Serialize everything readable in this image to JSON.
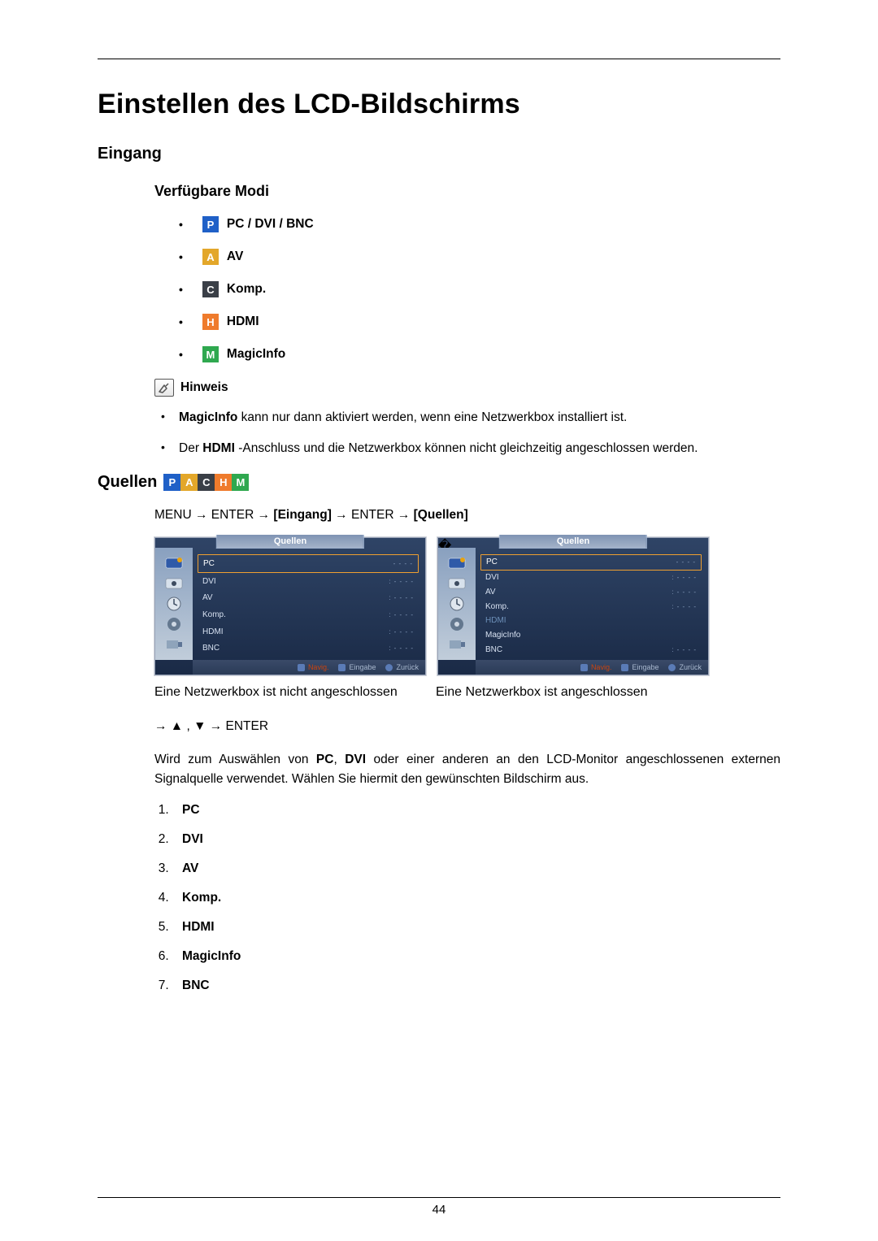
{
  "page_number": "44",
  "h1": "Einstellen des LCD-Bildschirms",
  "h2_eingang": "Eingang",
  "h3_modes": "Verfügbare Modi",
  "modes": [
    {
      "letter": "P",
      "cls": "sq-p",
      "label": "PC / DVI / BNC"
    },
    {
      "letter": "A",
      "cls": "sq-a",
      "label": "AV"
    },
    {
      "letter": "C",
      "cls": "sq-c",
      "label": "Komp."
    },
    {
      "letter": "H",
      "cls": "sq-h",
      "label": "HDMI"
    },
    {
      "letter": "M",
      "cls": "sq-m",
      "label": "MagicInfo"
    }
  ],
  "hinweis_label": "Hinweis",
  "notes": {
    "n1_strong": "MagicInfo",
    "n1_rest": " kann nur dann aktiviert werden, wenn eine Netzwerkbox installiert ist.",
    "n2_pre": "Der ",
    "n2_strong": "HDMI",
    "n2_rest": " -Anschluss und die Netzwerkbox können nicht gleichzeitig angeschlossen werden."
  },
  "quellen_label": "Quellen",
  "quellen_badges": [
    "P",
    "A",
    "C",
    "H",
    "M"
  ],
  "path": {
    "p1": "MENU → ENTER → ",
    "b1": "[Eingang]",
    "p2": " → ENTER → ",
    "b2": "[Quellen]"
  },
  "osd": {
    "title": "Quellen",
    "footer_nav": "Navig.",
    "footer_enter": "Eingabe",
    "footer_back": "Zurück",
    "left": {
      "rows": [
        {
          "label": "PC",
          "selected": true
        },
        {
          "label": "DVI"
        },
        {
          "label": "AV"
        },
        {
          "label": "Komp."
        },
        {
          "label": "HDMI"
        },
        {
          "label": "BNC"
        }
      ]
    },
    "right": {
      "rows": [
        {
          "label": "PC",
          "selected": true
        },
        {
          "label": "DVI"
        },
        {
          "label": "AV"
        },
        {
          "label": "Komp."
        },
        {
          "label": "HDMI",
          "dim": true
        },
        {
          "label": "MagicInfo"
        },
        {
          "label": "BNC"
        }
      ]
    }
  },
  "captions": {
    "left": "Eine Netzwerkbox ist nicht angeschlossen",
    "right": "Eine Netzwerkbox ist angeschlossen"
  },
  "nav_line": "→ ▲ , ▼ → ENTER",
  "desc": {
    "pre": "Wird zum Auswählen von ",
    "s1": "PC",
    "mid1": ", ",
    "s2": "DVI",
    "rest": " oder einer anderen an den LCD-Monitor angeschlossenen externen Signalquelle verwendet. Wählen Sie hiermit den gewünschten Bildschirm aus."
  },
  "sources_list": [
    "PC",
    "DVI",
    "AV",
    "Komp.",
    "HDMI",
    "MagicInfo",
    "BNC"
  ]
}
